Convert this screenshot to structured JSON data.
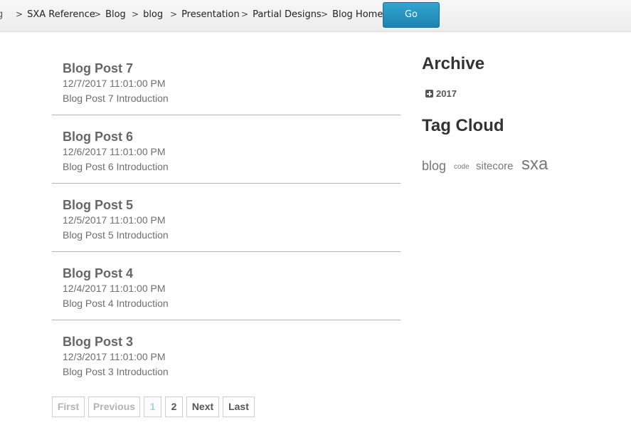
{
  "breadcrumb": {
    "cut_item": "g",
    "separator": ">",
    "items": [
      "SXA Reference",
      "Blog",
      "blog",
      "Presentation",
      "Partial Designs",
      "Blog Home"
    ]
  },
  "go_button": {
    "label": "Go"
  },
  "posts": [
    {
      "title": "Blog Post 7",
      "date": "12/7/2017 11:01:00 PM",
      "intro": "Blog Post 7 Introduction"
    },
    {
      "title": "Blog Post 6",
      "date": "12/6/2017 11:01:00 PM",
      "intro": "Blog Post 6 Introduction"
    },
    {
      "title": "Blog Post 5",
      "date": "12/5/2017 11:01:00 PM",
      "intro": "Blog Post 5 Introduction"
    },
    {
      "title": "Blog Post 4",
      "date": "12/4/2017 11:01:00 PM",
      "intro": "Blog Post 4 Introduction"
    },
    {
      "title": "Blog Post 3",
      "date": "12/3/2017 11:01:00 PM",
      "intro": "Blog Post 3 Introduction"
    }
  ],
  "pager": {
    "first": "First",
    "previous": "Previous",
    "pages": [
      "1",
      "2"
    ],
    "current_page": "1",
    "next": "Next",
    "last": "Last"
  },
  "sidebar": {
    "archive_title": "Archive",
    "archive_year": "2017",
    "tagcloud_title": "Tag Cloud",
    "tags": [
      "blog",
      "code",
      "sitecore",
      "sxa"
    ]
  },
  "colors": {
    "go_button": "#1d83b0",
    "post_divider": "#9bbfd2",
    "active_page": "#9fd4dc"
  }
}
